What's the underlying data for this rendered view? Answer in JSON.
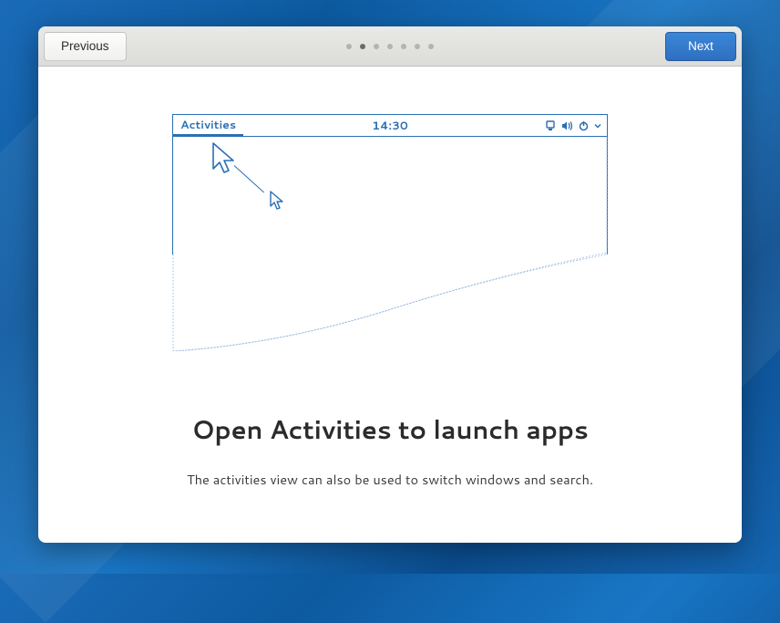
{
  "header": {
    "previous_label": "Previous",
    "next_label": "Next",
    "page_count": 7,
    "active_index": 1
  },
  "illustration": {
    "activities_label": "Activities",
    "clock": "14:30"
  },
  "main": {
    "heading": "Open Activities to launch apps",
    "subtext": "The activities view can also be used to switch windows and search."
  }
}
